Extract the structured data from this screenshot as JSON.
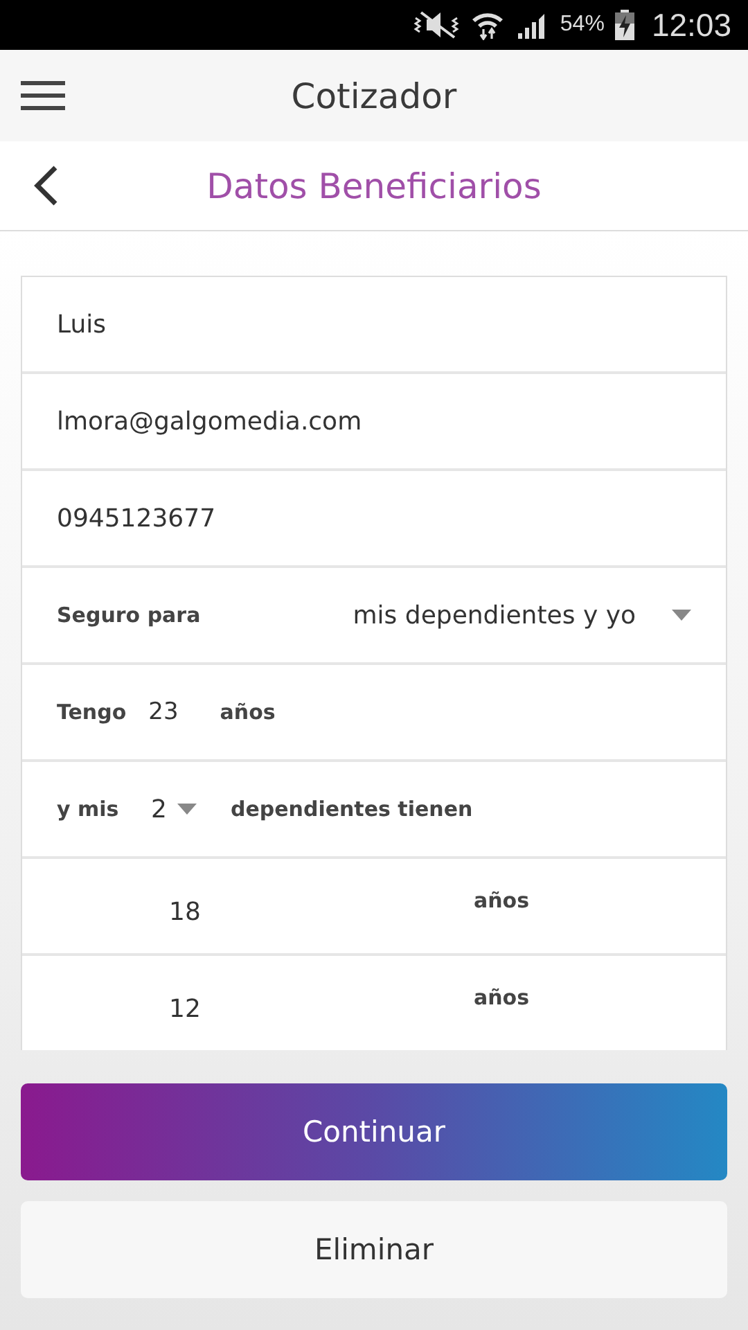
{
  "status_bar": {
    "battery": "54%",
    "time": "12:03"
  },
  "app_bar": {
    "title": "Cotizador"
  },
  "page": {
    "title": "Datos Beneficiarios"
  },
  "form": [
    {
      "kind": "text",
      "value": "Luis"
    },
    {
      "kind": "text",
      "value": "lmora@galgomedia.com"
    },
    {
      "kind": "text",
      "value": "0945123677"
    },
    {
      "kind": "select",
      "label": "Seguro para",
      "value": "mis dependientes y yo"
    },
    {
      "kind": "age",
      "label": "Tengo",
      "value": "23",
      "unit": "años"
    },
    {
      "kind": "count",
      "label": "y mis",
      "value": "2",
      "suffix": "dependientes tienen"
    },
    {
      "kind": "dependent",
      "value": "18",
      "unit": "años"
    },
    {
      "kind": "dependent",
      "value": "12",
      "unit": "años"
    }
  ],
  "buttons": [
    {
      "kind": "primary",
      "label": "Continuar"
    },
    {
      "kind": "secondary",
      "label": "Eliminar"
    }
  ]
}
